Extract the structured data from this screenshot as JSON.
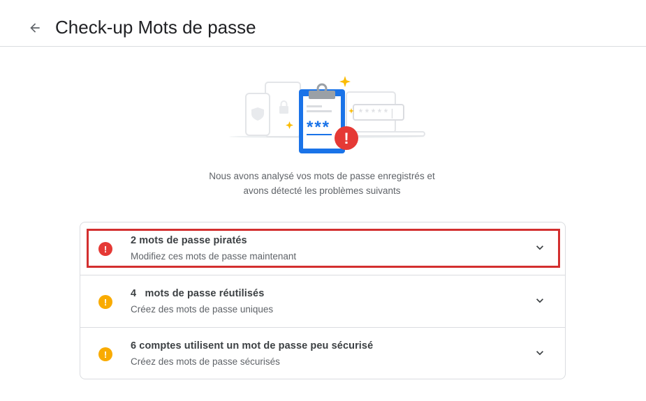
{
  "header": {
    "title": "Check-up Mots de passe",
    "back_icon": "arrow-back-icon"
  },
  "illustration": {
    "mask_text": "***",
    "field_text": "*****|",
    "alert_glyph": "!"
  },
  "intro": {
    "line1": "Nous avons analysé vos mots de passe enregistrés et",
    "line2": "avons détecté les problèmes suivants"
  },
  "issues": [
    {
      "title": "2 mots de passe piratés",
      "subtitle": "Modifiez ces mots de passe maintenant",
      "severity": "critical",
      "icon": "error-icon",
      "icon_glyph": "!",
      "color": "#e53935",
      "highlighted": true
    },
    {
      "title": "4   mots de passe réutilisés",
      "subtitle": "Créez des mots de passe uniques",
      "severity": "warning",
      "icon": "warning-icon",
      "icon_glyph": "!",
      "color": "#f9ab00",
      "highlighted": false
    },
    {
      "title": "6 comptes utilisent un mot de passe peu sécurisé",
      "subtitle": "Créez des mots de passe sécurisés",
      "severity": "warning",
      "icon": "warning-icon",
      "icon_glyph": "!",
      "color": "#f9ab00",
      "highlighted": false
    }
  ],
  "colors": {
    "accent_blue": "#1a73e8",
    "danger": "#e53935",
    "warning": "#f9ab00",
    "highlight_frame": "#d32f2f"
  }
}
